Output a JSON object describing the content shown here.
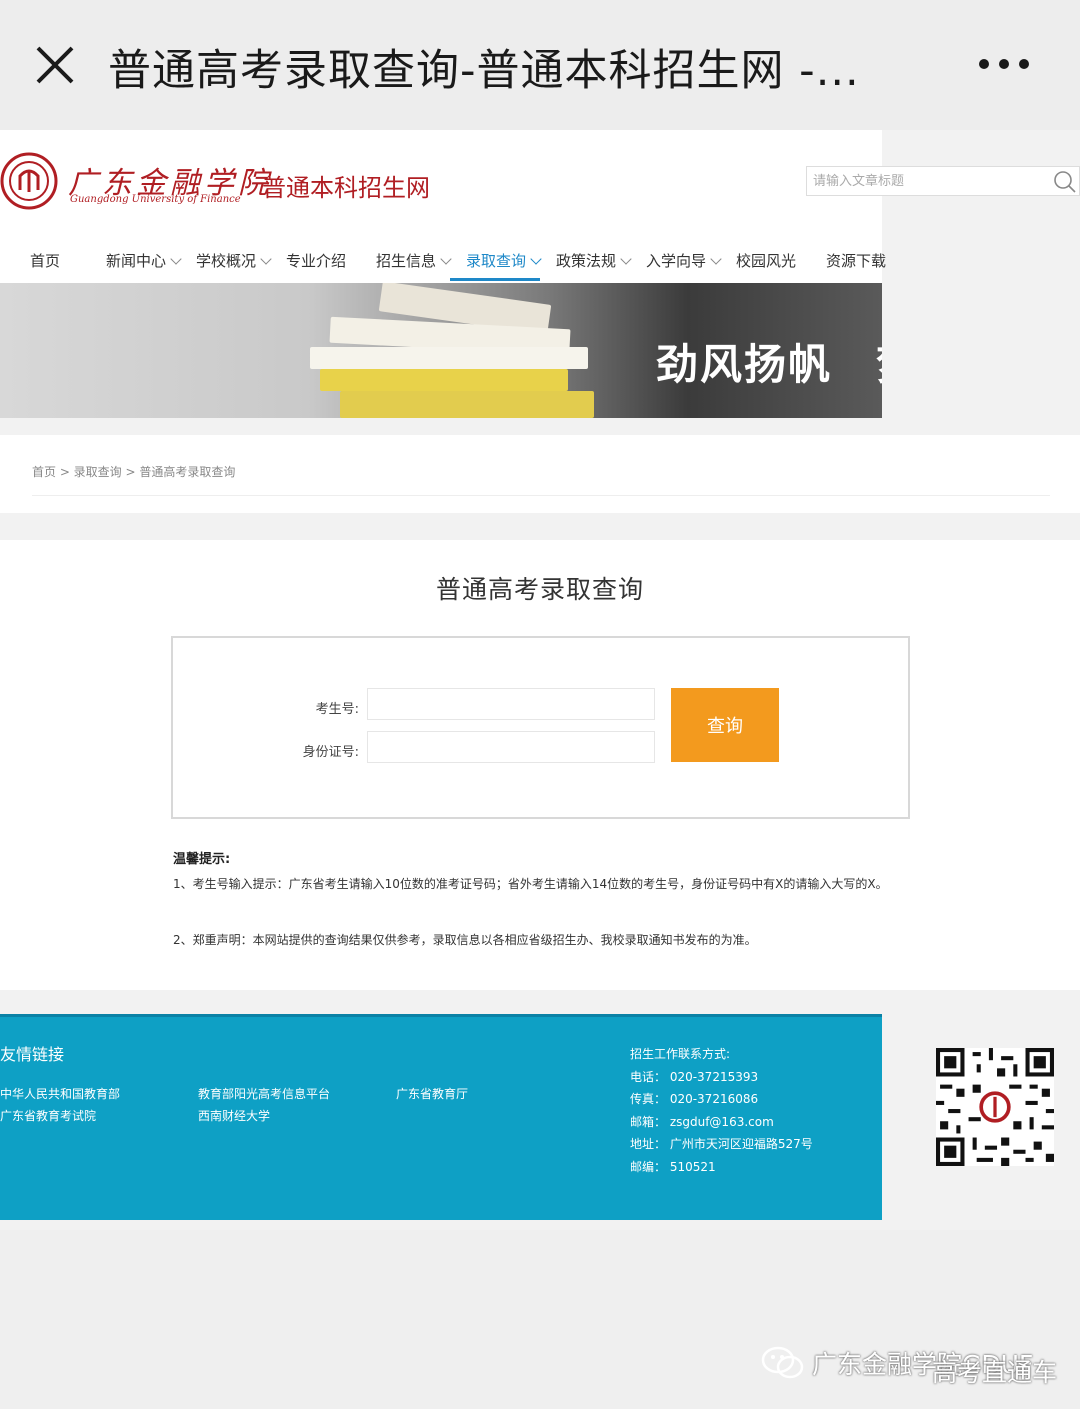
{
  "topbar": {
    "title": "普通高考录取查询-普通本科招生网 -..."
  },
  "header": {
    "logo_cn": "广东金融学院",
    "logo_en": "Guangdong University of Finance",
    "site_name": "普通本科招生网",
    "search_placeholder": "请输入文章标题"
  },
  "nav": {
    "items": [
      {
        "label": "首页"
      },
      {
        "label": "新闻中心"
      },
      {
        "label": "学校概况"
      },
      {
        "label": "专业介绍"
      },
      {
        "label": "招生信息"
      },
      {
        "label": "录取查询"
      },
      {
        "label": "政策法规"
      },
      {
        "label": "入学向导"
      },
      {
        "label": "校园风光"
      },
      {
        "label": "资源下载"
      }
    ],
    "active": "录取查询"
  },
  "banner": {
    "text": "劲风扬帆　梦"
  },
  "breadcrumb": "首页 > 录取查询 > 普通高考录取查询",
  "main": {
    "title": "普通高考录取查询",
    "exam_label": "考生号:",
    "id_label": "身份证号:",
    "query_button": "查询",
    "tips_title": "温馨提示:",
    "tip1": "1、考生号输入提示：广东省考生请输入10位数的准考证号码；省外考生请输入14位数的考生号，身份证号码中有X的请输入大写的X。",
    "tip2": "2、郑重声明：本网站提供的查询结果仅供参考，录取信息以各相应省级招生办、我校录取通知书发布的为准。"
  },
  "footer": {
    "heading": "友情链接",
    "links": [
      "中华人民共和国教育部",
      "广东省教育考试院",
      "教育部阳光高考信息平台",
      "西南财经大学",
      "广东省教育厅"
    ],
    "contact_title": "招生工作联系方式:",
    "phone": "电话：  020-37215393",
    "fax": "传真：  020-37216086",
    "email": "邮箱：  zsgduf@163.com",
    "address": "地址：  广州市天河区迎福路527号",
    "postcode": "邮编：  510521"
  },
  "watermark": {
    "text": "广东金融学院GDUF",
    "text2": "高考直通车"
  },
  "colors": {
    "brand_red": "#b01e23",
    "nav_active": "#1e88c8",
    "button": "#f39a1e",
    "footer": "#0ea0c5"
  }
}
